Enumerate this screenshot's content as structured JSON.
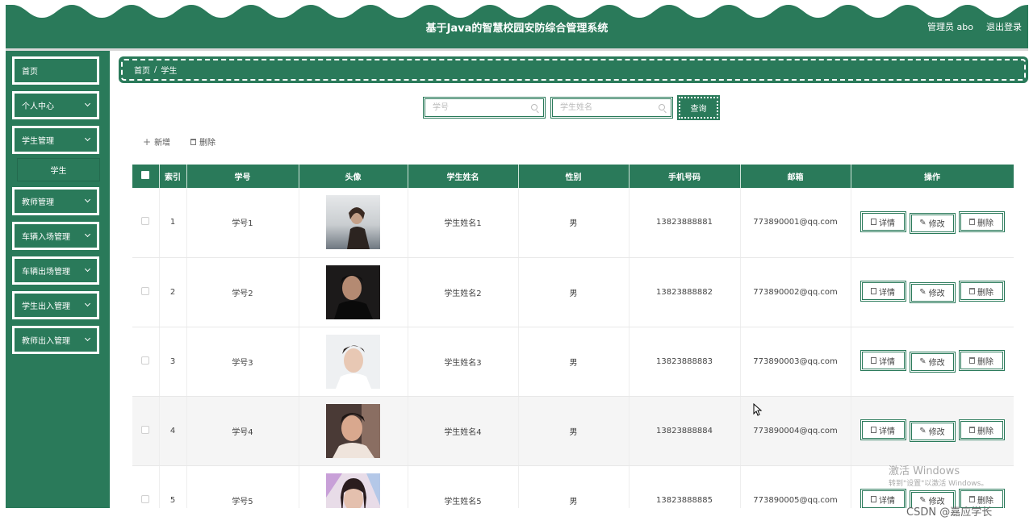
{
  "header": {
    "title": "基于Java的智慧校园安防综合管理系统",
    "user": "管理员 abo",
    "logout": "退出登录"
  },
  "sidebar": {
    "items": [
      {
        "label": "首页"
      },
      {
        "label": "个人中心"
      },
      {
        "label": "学生管理"
      },
      {
        "label": "教师管理"
      },
      {
        "label": "车辆入场管理"
      },
      {
        "label": "车辆出场管理"
      },
      {
        "label": "学生出入管理"
      },
      {
        "label": "教师出入管理"
      }
    ],
    "submenu_label": "学生"
  },
  "breadcrumb": {
    "home": "首页",
    "separator": "/",
    "current": "学生"
  },
  "search": {
    "student_no_placeholder": "学号",
    "student_name_placeholder": "学生姓名",
    "button": "查询"
  },
  "toolbar": {
    "add": "新增",
    "delete": "删除"
  },
  "table": {
    "headers": [
      "索引",
      "学号",
      "头像",
      "学生姓名",
      "性别",
      "手机号码",
      "邮箱",
      "操作"
    ],
    "actions": {
      "detail": "详情",
      "edit": "修改",
      "delete": "删除"
    },
    "rows": [
      {
        "index": "1",
        "no": "学号1",
        "name": "学生姓名1",
        "gender": "男",
        "phone": "13823888881",
        "email": "773890001@qq.com"
      },
      {
        "index": "2",
        "no": "学号2",
        "name": "学生姓名2",
        "gender": "男",
        "phone": "13823888882",
        "email": "773890002@qq.com"
      },
      {
        "index": "3",
        "no": "学号3",
        "name": "学生姓名3",
        "gender": "男",
        "phone": "13823888883",
        "email": "773890003@qq.com"
      },
      {
        "index": "4",
        "no": "学号4",
        "name": "学生姓名4",
        "gender": "男",
        "phone": "13823888884",
        "email": "773890004@qq.com"
      },
      {
        "index": "5",
        "no": "学号5",
        "name": "学生姓名5",
        "gender": "男",
        "phone": "13823888885",
        "email": "773890005@qq.com"
      }
    ]
  },
  "watermarks": {
    "windows_title": "激活 Windows",
    "windows_sub": "转到\"设置\"以激活 Windows。",
    "csdn": "CSDN @嘉应学长"
  },
  "colors": {
    "primary": "#2a7a5a",
    "header_text": "#ffffff"
  }
}
